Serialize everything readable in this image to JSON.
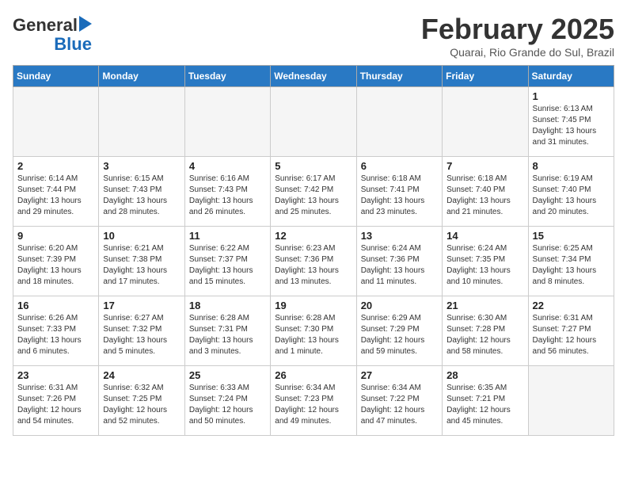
{
  "header": {
    "logo_line1": "General",
    "logo_line2": "Blue",
    "title": "February 2025",
    "subtitle": "Quarai, Rio Grande do Sul, Brazil"
  },
  "weekdays": [
    "Sunday",
    "Monday",
    "Tuesday",
    "Wednesday",
    "Thursday",
    "Friday",
    "Saturday"
  ],
  "weeks": [
    [
      {
        "day": "",
        "info": ""
      },
      {
        "day": "",
        "info": ""
      },
      {
        "day": "",
        "info": ""
      },
      {
        "day": "",
        "info": ""
      },
      {
        "day": "",
        "info": ""
      },
      {
        "day": "",
        "info": ""
      },
      {
        "day": "1",
        "info": "Sunrise: 6:13 AM\nSunset: 7:45 PM\nDaylight: 13 hours\nand 31 minutes."
      }
    ],
    [
      {
        "day": "2",
        "info": "Sunrise: 6:14 AM\nSunset: 7:44 PM\nDaylight: 13 hours\nand 29 minutes."
      },
      {
        "day": "3",
        "info": "Sunrise: 6:15 AM\nSunset: 7:43 PM\nDaylight: 13 hours\nand 28 minutes."
      },
      {
        "day": "4",
        "info": "Sunrise: 6:16 AM\nSunset: 7:43 PM\nDaylight: 13 hours\nand 26 minutes."
      },
      {
        "day": "5",
        "info": "Sunrise: 6:17 AM\nSunset: 7:42 PM\nDaylight: 13 hours\nand 25 minutes."
      },
      {
        "day": "6",
        "info": "Sunrise: 6:18 AM\nSunset: 7:41 PM\nDaylight: 13 hours\nand 23 minutes."
      },
      {
        "day": "7",
        "info": "Sunrise: 6:18 AM\nSunset: 7:40 PM\nDaylight: 13 hours\nand 21 minutes."
      },
      {
        "day": "8",
        "info": "Sunrise: 6:19 AM\nSunset: 7:40 PM\nDaylight: 13 hours\nand 20 minutes."
      }
    ],
    [
      {
        "day": "9",
        "info": "Sunrise: 6:20 AM\nSunset: 7:39 PM\nDaylight: 13 hours\nand 18 minutes."
      },
      {
        "day": "10",
        "info": "Sunrise: 6:21 AM\nSunset: 7:38 PM\nDaylight: 13 hours\nand 17 minutes."
      },
      {
        "day": "11",
        "info": "Sunrise: 6:22 AM\nSunset: 7:37 PM\nDaylight: 13 hours\nand 15 minutes."
      },
      {
        "day": "12",
        "info": "Sunrise: 6:23 AM\nSunset: 7:36 PM\nDaylight: 13 hours\nand 13 minutes."
      },
      {
        "day": "13",
        "info": "Sunrise: 6:24 AM\nSunset: 7:36 PM\nDaylight: 13 hours\nand 11 minutes."
      },
      {
        "day": "14",
        "info": "Sunrise: 6:24 AM\nSunset: 7:35 PM\nDaylight: 13 hours\nand 10 minutes."
      },
      {
        "day": "15",
        "info": "Sunrise: 6:25 AM\nSunset: 7:34 PM\nDaylight: 13 hours\nand 8 minutes."
      }
    ],
    [
      {
        "day": "16",
        "info": "Sunrise: 6:26 AM\nSunset: 7:33 PM\nDaylight: 13 hours\nand 6 minutes."
      },
      {
        "day": "17",
        "info": "Sunrise: 6:27 AM\nSunset: 7:32 PM\nDaylight: 13 hours\nand 5 minutes."
      },
      {
        "day": "18",
        "info": "Sunrise: 6:28 AM\nSunset: 7:31 PM\nDaylight: 13 hours\nand 3 minutes."
      },
      {
        "day": "19",
        "info": "Sunrise: 6:28 AM\nSunset: 7:30 PM\nDaylight: 13 hours\nand 1 minute."
      },
      {
        "day": "20",
        "info": "Sunrise: 6:29 AM\nSunset: 7:29 PM\nDaylight: 12 hours\nand 59 minutes."
      },
      {
        "day": "21",
        "info": "Sunrise: 6:30 AM\nSunset: 7:28 PM\nDaylight: 12 hours\nand 58 minutes."
      },
      {
        "day": "22",
        "info": "Sunrise: 6:31 AM\nSunset: 7:27 PM\nDaylight: 12 hours\nand 56 minutes."
      }
    ],
    [
      {
        "day": "23",
        "info": "Sunrise: 6:31 AM\nSunset: 7:26 PM\nDaylight: 12 hours\nand 54 minutes."
      },
      {
        "day": "24",
        "info": "Sunrise: 6:32 AM\nSunset: 7:25 PM\nDaylight: 12 hours\nand 52 minutes."
      },
      {
        "day": "25",
        "info": "Sunrise: 6:33 AM\nSunset: 7:24 PM\nDaylight: 12 hours\nand 50 minutes."
      },
      {
        "day": "26",
        "info": "Sunrise: 6:34 AM\nSunset: 7:23 PM\nDaylight: 12 hours\nand 49 minutes."
      },
      {
        "day": "27",
        "info": "Sunrise: 6:34 AM\nSunset: 7:22 PM\nDaylight: 12 hours\nand 47 minutes."
      },
      {
        "day": "28",
        "info": "Sunrise: 6:35 AM\nSunset: 7:21 PM\nDaylight: 12 hours\nand 45 minutes."
      },
      {
        "day": "",
        "info": ""
      }
    ]
  ]
}
